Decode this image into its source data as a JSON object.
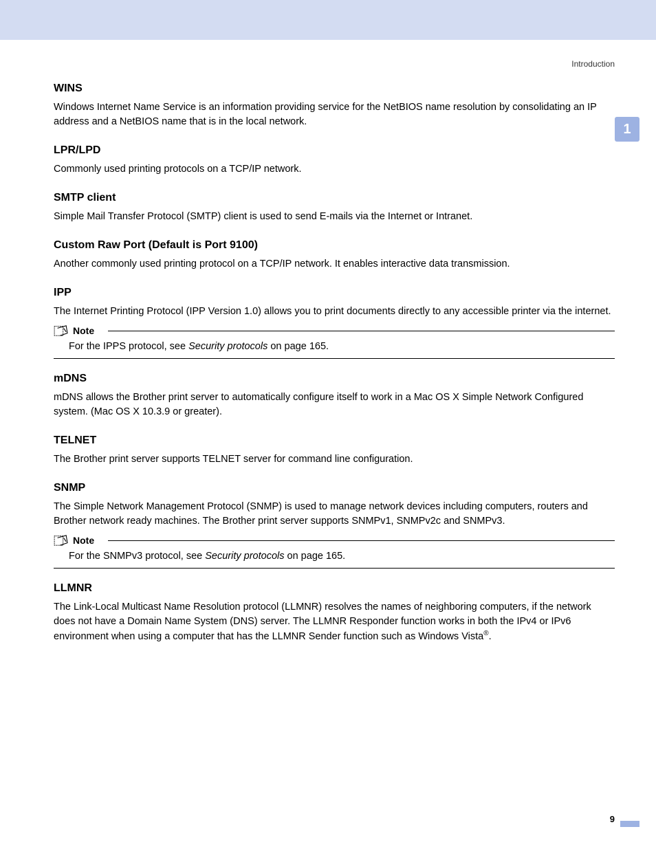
{
  "header": {
    "section_label": "Introduction",
    "chapter_number": "1"
  },
  "sections": {
    "wins": {
      "title": "WINS",
      "body": "Windows Internet Name Service is an information providing service for the NetBIOS name resolution by consolidating an IP address and a NetBIOS name that is in the local network."
    },
    "lpr": {
      "title": "LPR/LPD",
      "body": "Commonly used printing protocols on a TCP/IP network."
    },
    "smtp": {
      "title": "SMTP client",
      "body": "Simple Mail Transfer Protocol (SMTP) client is used to send E-mails via the Internet or Intranet."
    },
    "raw": {
      "title": "Custom Raw Port (Default is Port 9100)",
      "body": "Another commonly used printing protocol on a TCP/IP network. It enables interactive data transmission."
    },
    "ipp": {
      "title": "IPP",
      "body": "The Internet Printing Protocol (IPP Version 1.0) allows you to print documents directly to any accessible printer via the internet."
    },
    "mdns": {
      "title": "mDNS",
      "body": "mDNS allows the Brother print server to automatically configure itself to work in a Mac OS X Simple Network Configured system. (Mac OS X 10.3.9 or greater)."
    },
    "telnet": {
      "title": "TELNET",
      "body": "The Brother print server supports TELNET server for command line configuration."
    },
    "snmp": {
      "title": "SNMP",
      "body": "The Simple Network Management Protocol (SNMP) is used to manage network devices including computers, routers and Brother network ready machines. The Brother print server supports SNMPv1, SNMPv2c and SNMPv3."
    },
    "llmnr": {
      "title": "LLMNR",
      "body_pre": "The Link-Local Multicast Name Resolution protocol (LLMNR) resolves the names of neighboring computers, if the network does not have a Domain Name System (DNS) server. The LLMNR Responder function works in both the IPv4 or IPv6 environment when using a computer that has the LLMNR Sender function such as Windows Vista",
      "body_post": "."
    }
  },
  "notes": {
    "label": "Note",
    "ipp": {
      "pre": "For the IPPS protocol, see ",
      "italic": "Security protocols",
      "post": " on page 165."
    },
    "snmp": {
      "pre": "For the SNMPv3 protocol, see ",
      "italic": "Security protocols",
      "post": " on page 165."
    }
  },
  "footer": {
    "page_number": "9"
  }
}
